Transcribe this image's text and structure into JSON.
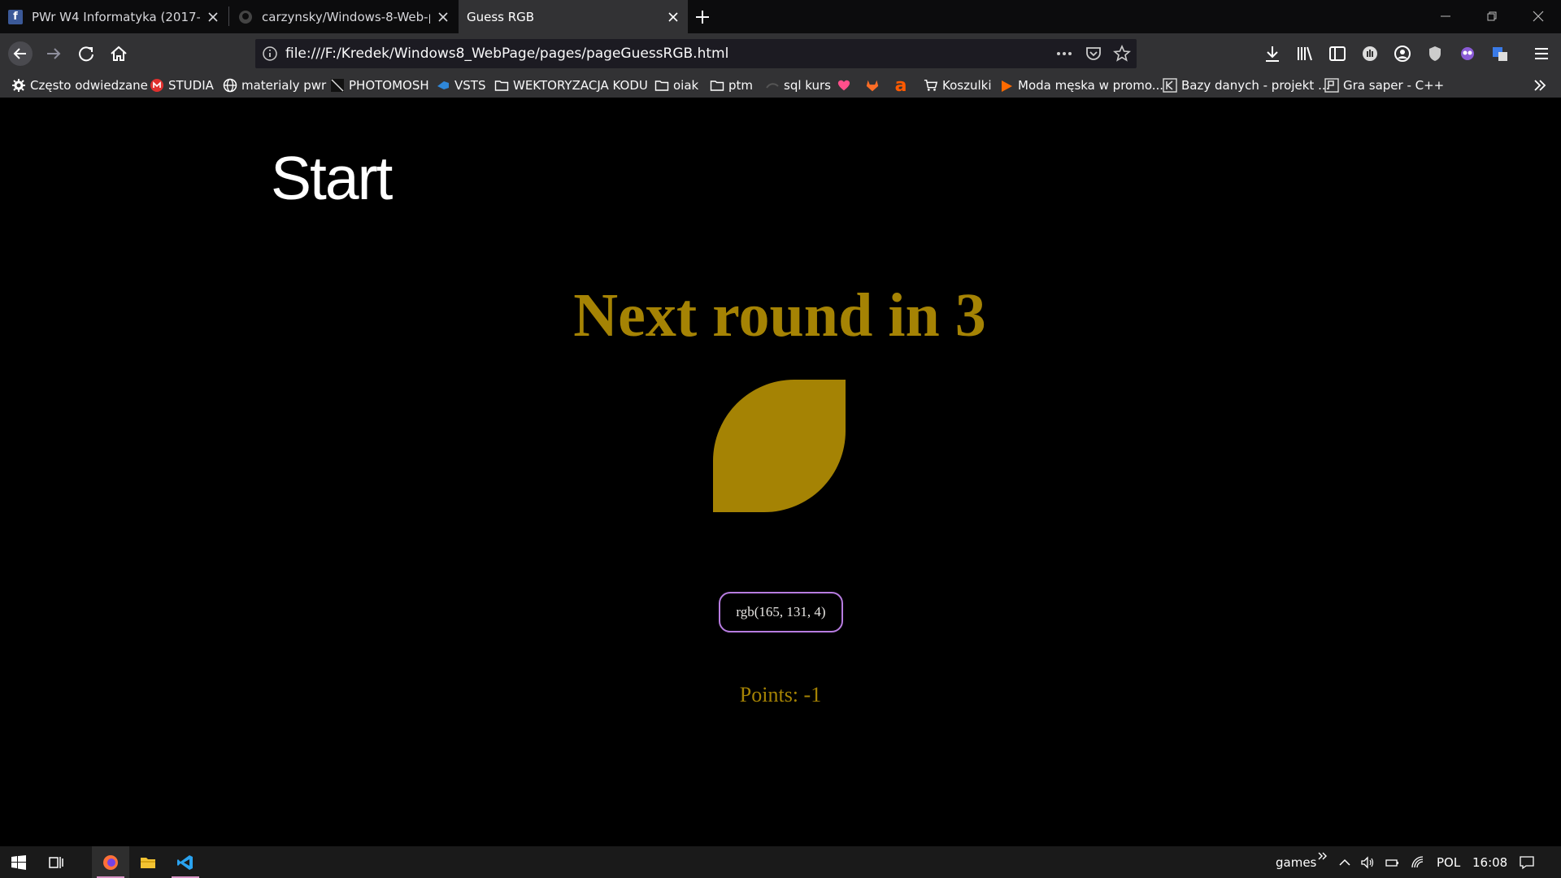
{
  "browser": {
    "tabs": [
      {
        "title": "PWr W4 Informatyka (2017–2021)",
        "icon": "facebook-icon"
      },
      {
        "title": "carzynsky/Windows-8-Web-page",
        "icon": "github-icon"
      },
      {
        "title": "Guess RGB",
        "icon": "none",
        "active": true
      }
    ],
    "url": "file:///F:/Kredek/Windows8_WebPage/pages/pageGuessRGB.html",
    "bookmarks": [
      {
        "label": "Często odwiedzane",
        "icon": "gear-icon"
      },
      {
        "label": "STUDIA",
        "icon": "gmail-icon"
      },
      {
        "label": "materialy pwr",
        "icon": "globe-icon"
      },
      {
        "label": "PHOTOMOSH",
        "icon": "photomosh-icon"
      },
      {
        "label": "VSTS",
        "icon": "vsts-icon"
      },
      {
        "label": "WEKTORYZACJA KODU",
        "icon": "folder-icon"
      },
      {
        "label": "oiak",
        "icon": "folder-icon"
      },
      {
        "label": "ptm",
        "icon": "folder-icon"
      },
      {
        "label": "sql kurs",
        "icon": "sql-icon"
      },
      {
        "label": "",
        "icon": "heart-icon"
      },
      {
        "label": "",
        "icon": "gitlab-icon"
      },
      {
        "label": "",
        "icon": "allegro-icon"
      },
      {
        "label": "Koszulki",
        "icon": "cart-icon"
      },
      {
        "label": "Moda męska w promo...",
        "icon": "flame-icon"
      },
      {
        "label": "Bazy danych - projekt ...",
        "icon": "k-icon"
      },
      {
        "label": "Gra saper - C++",
        "icon": "p-icon"
      }
    ]
  },
  "page": {
    "start_title": "Start",
    "round_heading": "Next round in 3",
    "shape_color": "#a58304",
    "rgb_answer": "rgb(165, 131, 4)",
    "points": "Points: -1"
  },
  "taskbar": {
    "apps": [
      "windows-start-icon",
      "task-view-icon",
      "firefox-icon",
      "file-explorer-icon",
      "vscode-icon"
    ],
    "tray_label": "games",
    "language": "POL",
    "time": "16:08"
  },
  "colors": {
    "accent_gold": "#a58304",
    "button_border": "#b77ce0",
    "background": "#000000"
  }
}
